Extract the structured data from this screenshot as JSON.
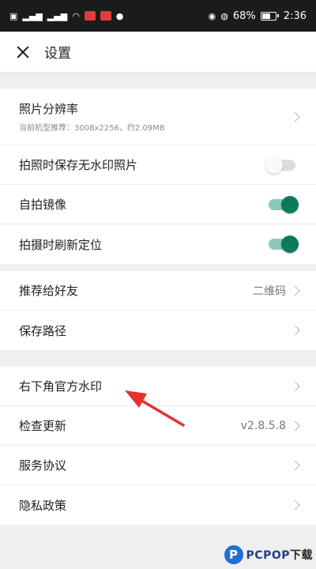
{
  "status_bar": {
    "battery": "68%",
    "time": "2:36"
  },
  "header": {
    "title": "设置"
  },
  "groups": [
    {
      "rows": [
        {
          "label": "照片分辨率",
          "sublabel": "当前机型推荐：3008x2256，约2.09MB",
          "control": "chevron"
        },
        {
          "label": "拍照时保存无水印照片",
          "control": "toggle",
          "on": false
        },
        {
          "label": "自拍镜像",
          "control": "toggle",
          "on": true
        },
        {
          "label": "拍摄时刷新定位",
          "control": "toggle",
          "on": true
        }
      ]
    },
    {
      "rows": [
        {
          "label": "推荐给好友",
          "value": "二维码",
          "control": "chevron"
        },
        {
          "label": "保存路径",
          "control": "chevron"
        }
      ]
    },
    {
      "rows": [
        {
          "label": "右下角官方水印",
          "control": "chevron"
        },
        {
          "label": "检查更新",
          "value": "v2.8.5.8",
          "control": "chevron"
        },
        {
          "label": "服务协议",
          "control": "chevron"
        },
        {
          "label": "隐私政策",
          "control": "chevron"
        }
      ]
    }
  ],
  "colors": {
    "toggle_on": "#0e7a5c",
    "annotation_arrow": "#e2332e"
  },
  "watermark": {
    "logo_letter": "P",
    "brand": "PCPOP",
    "suffix": "下载"
  }
}
